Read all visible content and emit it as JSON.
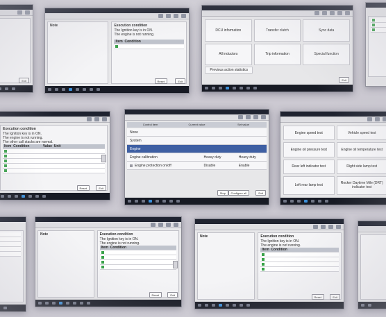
{
  "exec_panel": {
    "title": "Execution condition",
    "lines": [
      "The Ignition key is in ON.",
      "The engine is not running.",
      "The other call stacks are normal."
    ],
    "table_headers": [
      "Item",
      "Condition",
      "Value",
      "Unit"
    ]
  },
  "note_panel": {
    "title": "Note"
  },
  "buttons": {
    "reset": "Reset",
    "exit": "Exit",
    "normal": "Normal",
    "stop": "Stop",
    "configure_all": "Configure all"
  },
  "screen_a": {
    "items": [
      "Engine speed test",
      "Vehicle speed test",
      "Engine oil pressure test",
      "Engine oil temperature test",
      "Rear left indicator test",
      "Right side lamp test",
      "Left rear lamp test",
      "Rocker Daytime Mile (DRT) indicator test"
    ]
  },
  "screen_b": {
    "headers": [
      "Control item",
      "Current value",
      "Set value"
    ],
    "options": [
      "None",
      "System",
      "Engine"
    ],
    "fields": [
      {
        "label": "Engine calibration",
        "current": "Heavy duty",
        "target": "Heavy duty"
      },
      {
        "label": "Engine protection on/off",
        "current": "Disable",
        "target": "Enable"
      }
    ]
  },
  "screen_c": {
    "items": [
      "DCU information",
      "Transfer clutch",
      "Sync data",
      "All inductors",
      "Trip information",
      "Special function",
      "Previous action statistics"
    ]
  }
}
